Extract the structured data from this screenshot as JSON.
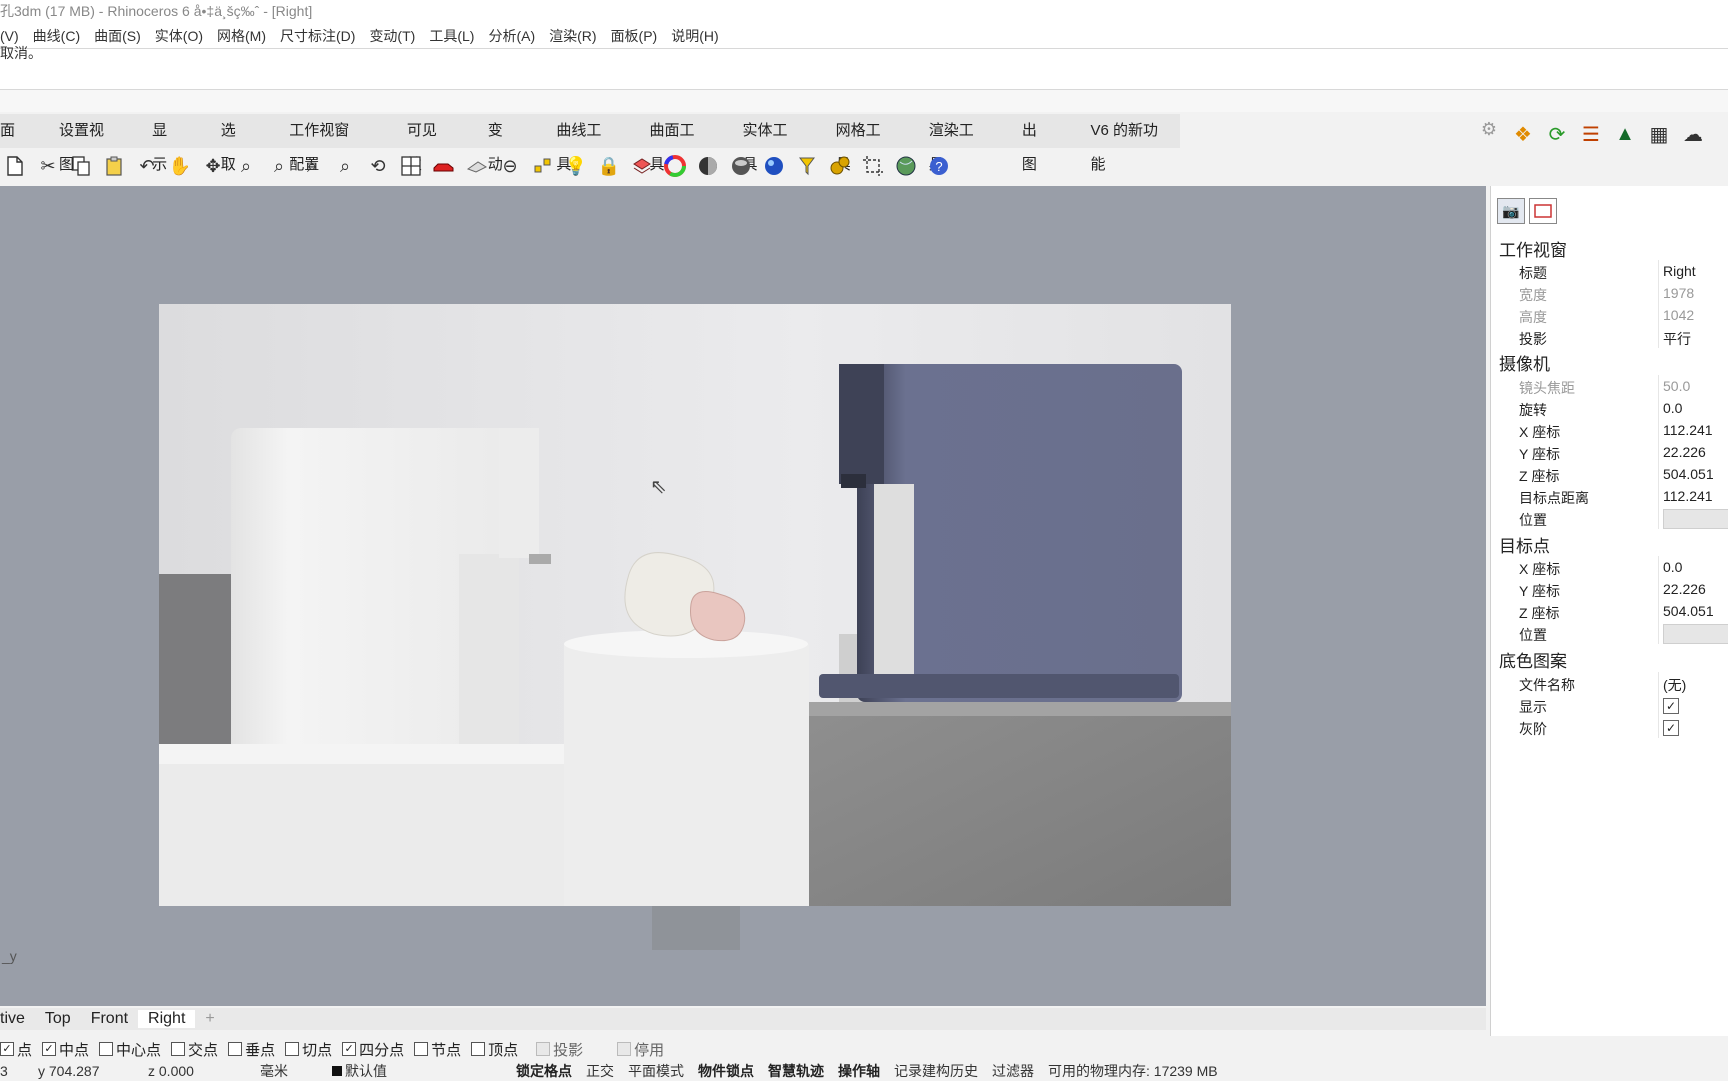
{
  "window": {
    "title": "孔3dm (17 MB) - Rhinoceros 6 å•‡ä¸šç‰ˆ - [Right]"
  },
  "menus": [
    "(V)",
    "曲线(C)",
    "曲面(S)",
    "实体(O)",
    "网格(M)",
    "尺寸标注(D)",
    "变动(T)",
    "工具(L)",
    "分析(A)",
    "渲染(R)",
    "面板(P)",
    "说明(H)"
  ],
  "command_history": "取消。",
  "tabs": [
    "面",
    "设置视图",
    "显示",
    "选取",
    "工作视窗配置",
    "可见性",
    "变动",
    "曲线工具",
    "曲面工具",
    "实体工具",
    "网格工具",
    "渲染工具",
    "出图",
    "V6 的新功能"
  ],
  "viewport": {
    "cursor_glyph": "⇖",
    "axis_label": "_y"
  },
  "view_tabs": [
    "tive",
    "Top",
    "Front",
    "Right"
  ],
  "add_view_glyph": "+",
  "osnaps": [
    {
      "label": "点",
      "checked": true
    },
    {
      "label": "中点",
      "checked": true
    },
    {
      "label": "中心点",
      "checked": false
    },
    {
      "label": "交点",
      "checked": false
    },
    {
      "label": "垂点",
      "checked": false
    },
    {
      "label": "切点",
      "checked": false
    },
    {
      "label": "四分点",
      "checked": true
    },
    {
      "label": "节点",
      "checked": false
    },
    {
      "label": "顶点",
      "checked": false
    },
    {
      "label": "投影",
      "checked": false,
      "disabled": true
    },
    {
      "label": "停用",
      "checked": false,
      "disabled": true
    }
  ],
  "status": {
    "coord_prefix": "3",
    "y": "y 704.287",
    "z": "z 0.000",
    "unit": "毫米",
    "layer": "默认值",
    "items": [
      "锁定格点",
      "正交",
      "平面模式",
      "物件锁点",
      "智慧轨迹",
      "操作轴",
      "记录建构历史",
      "过滤器"
    ],
    "bold_items": [
      "锁定格点",
      "物件锁点",
      "智慧轨迹",
      "操作轴"
    ],
    "memory": "可用的物理内存: 17239 MB"
  },
  "panel": {
    "sections": {
      "viewport": {
        "title": "工作视窗",
        "rows": [
          {
            "k": "标题",
            "v": "Right"
          },
          {
            "k": "宽度",
            "v": "1978",
            "dim": true
          },
          {
            "k": "高度",
            "v": "1042",
            "dim": true
          },
          {
            "k": "投影",
            "v": "平行"
          }
        ]
      },
      "camera": {
        "title": "摄像机",
        "rows": [
          {
            "k": "镜头焦距",
            "v": "50.0",
            "dim": true
          },
          {
            "k": "旋转",
            "v": "0.0"
          },
          {
            "k": "X 座标",
            "v": "112.241"
          },
          {
            "k": "Y 座标",
            "v": "22.226"
          },
          {
            "k": "Z 座标",
            "v": "504.051"
          },
          {
            "k": "目标点距离",
            "v": "112.241"
          },
          {
            "k": "位置",
            "v": ""
          }
        ]
      },
      "target": {
        "title": "目标点",
        "rows": [
          {
            "k": "X 座标",
            "v": "0.0"
          },
          {
            "k": "Y 座标",
            "v": "22.226"
          },
          {
            "k": "Z 座标",
            "v": "504.051"
          },
          {
            "k": "位置",
            "v": ""
          }
        ]
      },
      "wallpaper": {
        "title": "底色图案",
        "rows": [
          {
            "k": "文件名称",
            "v": "(无)"
          },
          {
            "k": "显示",
            "checked": true
          },
          {
            "k": "灰阶",
            "checked": true
          }
        ]
      }
    }
  },
  "colors": {
    "viewport_bg": "#999ea8",
    "render_bg": "#e4e4e6",
    "appliance_white": "#f1f1f1",
    "appliance_navy": "#6b7190",
    "pebble_white": "#eeece6",
    "pebble_pink": "#e9c6c0",
    "concrete": "#8a8a8a"
  },
  "icons": {
    "gear": "gear-icon",
    "toolbar": [
      "new-file-icon",
      "cut-icon",
      "copy-icon",
      "paste-icon",
      "undo-icon",
      "pan-hand-icon",
      "rotate-view-icon",
      "zoom-icon",
      "zoom-window-icon",
      "zoom-extents-icon",
      "zoom-selected-icon",
      "rotate-camera-icon",
      "viewport-layout-icon",
      "car-icon",
      "plane-icon",
      "dim-icon",
      "explode-icon",
      "light-bulb-icon",
      "lock-icon",
      "layer-icon",
      "color-wheel-icon",
      "render-ball-dark-icon",
      "render-ball-metal-icon",
      "render-ball-blue-icon",
      "filter-icon",
      "gears-icon",
      "crop-icon",
      "globe-icon",
      "help-icon"
    ],
    "right_tools": [
      "grasshopper-icon",
      "sync-icon",
      "layers-swap-icon",
      "tree-icon",
      "checker-icon",
      "cloud-icon"
    ]
  }
}
